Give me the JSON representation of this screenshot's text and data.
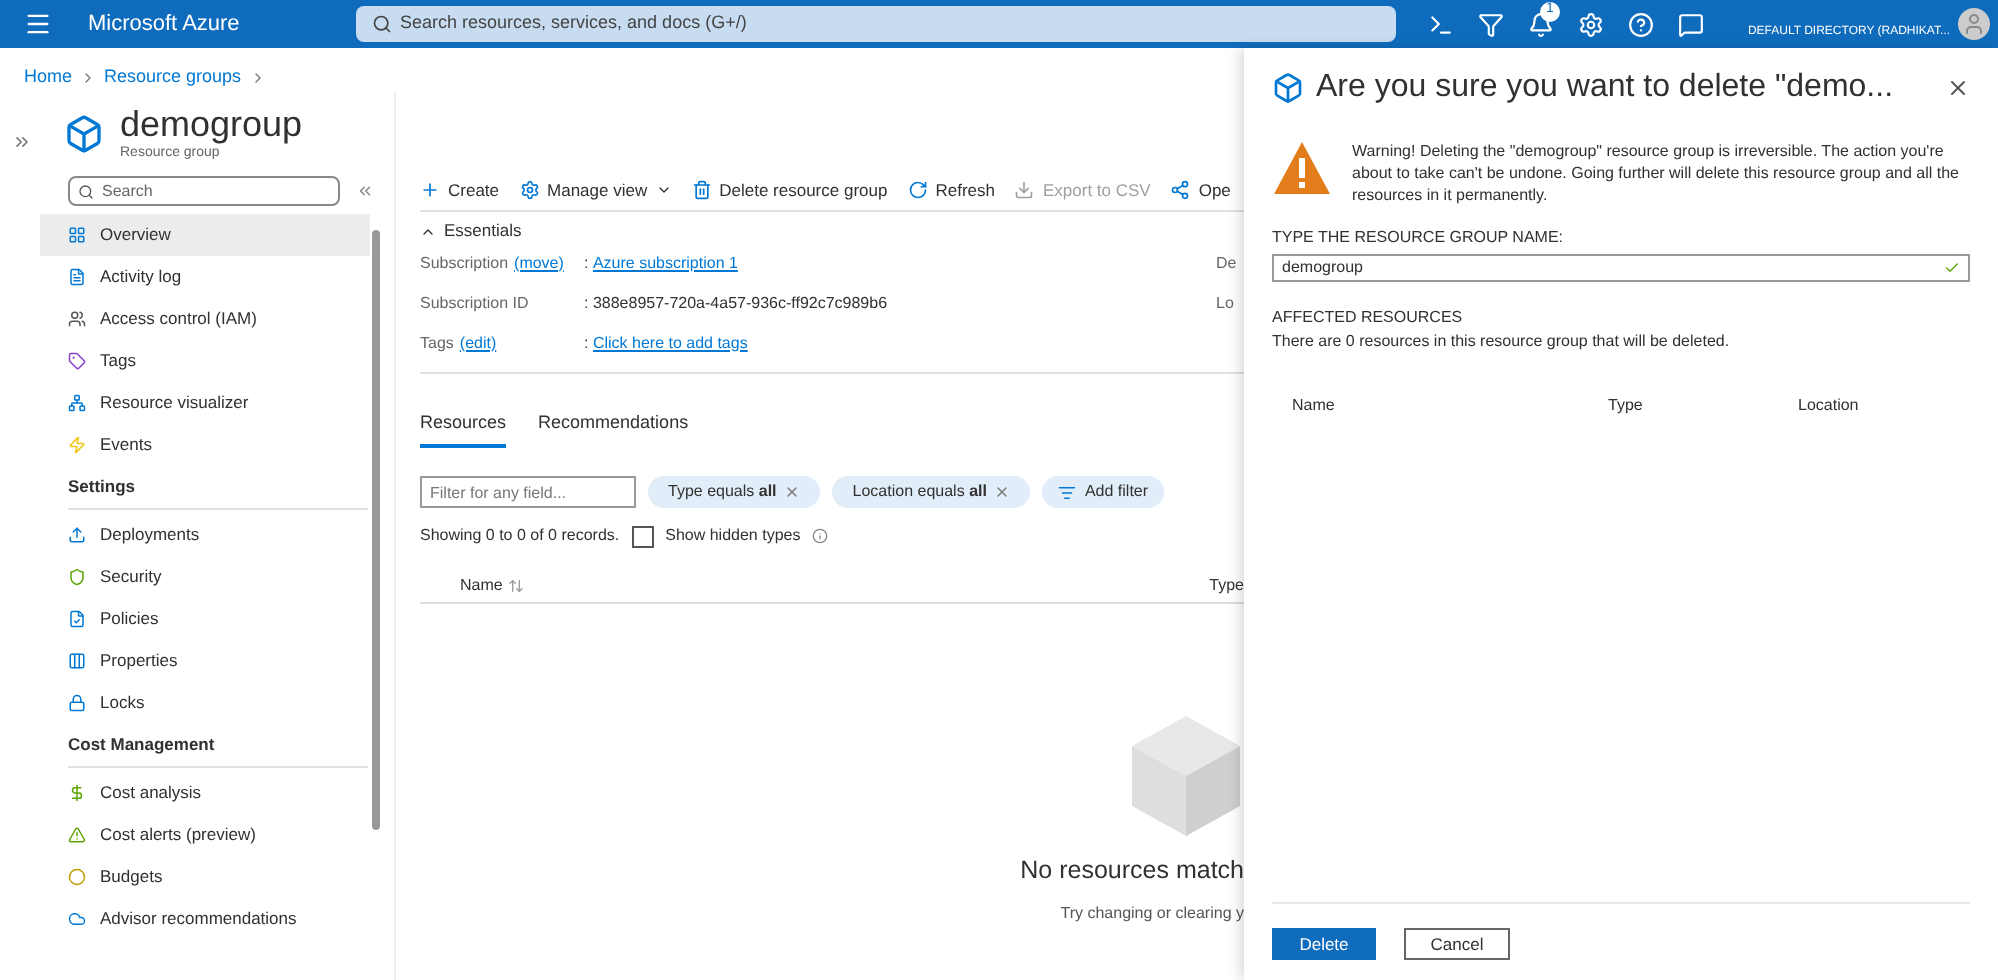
{
  "top_bar": {
    "brand": "Microsoft Azure",
    "search_placeholder": "Search resources, services, and docs (G+/)",
    "notification_count": "1",
    "directory": "DEFAULT DIRECTORY (RADHIKAT..."
  },
  "breadcrumb": [
    "Home",
    "Resource groups"
  ],
  "resource": {
    "name": "demogroup",
    "subtitle": "Resource group"
  },
  "sidebar": {
    "search_placeholder": "Search",
    "sections": [
      {
        "items": [
          {
            "label": "Overview",
            "selected": true
          },
          {
            "label": "Activity log",
            "selected": false
          },
          {
            "label": "Access control (IAM)",
            "selected": false
          },
          {
            "label": "Tags",
            "selected": false
          },
          {
            "label": "Resource visualizer",
            "selected": false
          },
          {
            "label": "Events",
            "selected": false
          }
        ]
      },
      {
        "heading": "Settings",
        "items": [
          {
            "label": "Deployments",
            "selected": false
          },
          {
            "label": "Security",
            "selected": false
          },
          {
            "label": "Policies",
            "selected": false
          },
          {
            "label": "Properties",
            "selected": false
          },
          {
            "label": "Locks",
            "selected": false
          }
        ]
      },
      {
        "heading": "Cost Management",
        "items": [
          {
            "label": "Cost analysis",
            "selected": false
          },
          {
            "label": "Cost alerts (preview)",
            "selected": false
          },
          {
            "label": "Budgets",
            "selected": false
          },
          {
            "label": "Advisor recommendations",
            "selected": false
          }
        ]
      }
    ]
  },
  "toolbar": [
    {
      "label": "Create",
      "disabled": false
    },
    {
      "label": "Manage view",
      "disabled": false
    },
    {
      "label": "Delete resource group",
      "disabled": false
    },
    {
      "label": "Refresh",
      "disabled": false
    },
    {
      "label": "Export to CSV",
      "disabled": true
    },
    {
      "label": "Ope",
      "disabled": false
    }
  ],
  "essentials": {
    "title": "Essentials",
    "expanded": true,
    "rows": [
      {
        "label": "Subscription",
        "action": "(move)",
        "value": ": ",
        "link": "Azure subscription 1"
      },
      {
        "label": "Subscription ID",
        "action": "",
        "value": ": 388e8957-720a-4a57-936c-ff92c7c989b6",
        "link": ""
      },
      {
        "label": "Tags",
        "action": "(edit)",
        "value": ": ",
        "link": "Click here to add tags"
      }
    ],
    "right_labels": [
      "De",
      "Lo"
    ]
  },
  "tabs": [
    {
      "label": "Resources",
      "selected": true
    },
    {
      "label": "Recommendations",
      "selected": false
    }
  ],
  "filters": {
    "placeholder": "Filter for any field...",
    "chips": [
      {
        "label": "Type equals",
        "value": "all"
      },
      {
        "label": "Location equals",
        "value": "all"
      }
    ],
    "add_filter": "Add filter"
  },
  "records": "Showing 0 to 0 of 0 records.",
  "show_hidden": {
    "label": "Show hidden types",
    "checked": false
  },
  "columns": [
    "Name",
    "Type"
  ],
  "empty": {
    "title": "No resources match",
    "subtitle": "Try changing or clearing y"
  },
  "dialog": {
    "title": "Are you sure you want to delete \"demo...",
    "warning": "Warning! Deleting the \"demogroup\" resource group is irreversible. The action you're about to take can't be undone. Going further will delete this resource group and all the resources in it permanently.",
    "name_label": "TYPE THE RESOURCE GROUP NAME:",
    "name_value": "demogroup",
    "valid": true,
    "affected_heading": "AFFECTED RESOURCES",
    "affected_text": "There are 0 resources in this resource group that will be deleted.",
    "columns": [
      "Name",
      "Type",
      "Location"
    ],
    "buttons": [
      {
        "label": "Delete",
        "kind": "primary"
      },
      {
        "label": "Cancel",
        "kind": "secondary"
      }
    ]
  }
}
